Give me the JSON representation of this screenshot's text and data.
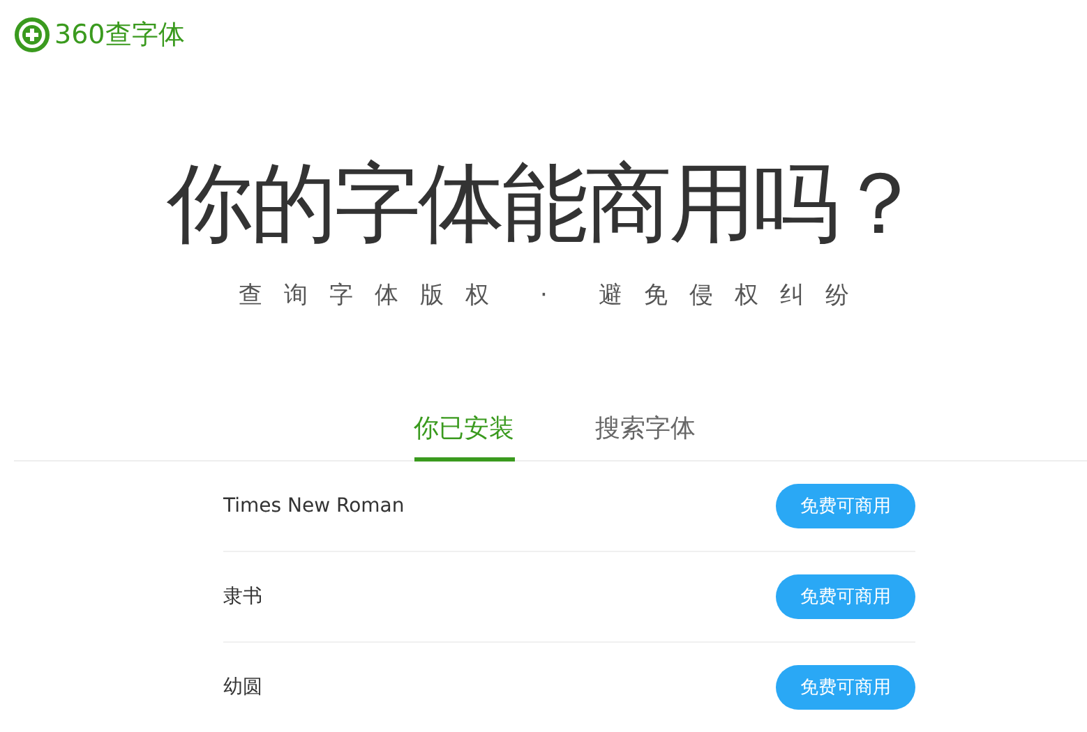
{
  "logo": {
    "text": "360查字体"
  },
  "hero": {
    "title": "你的字体能商用吗？",
    "subtitle": "查询字体版权 · 避免侵权纠纷"
  },
  "tabs": [
    {
      "label": "你已安装",
      "selected": true
    },
    {
      "label": "搜索字体",
      "selected": false
    }
  ],
  "fonts": [
    {
      "name": "Times New Roman",
      "status": "免费可商用"
    },
    {
      "name": "隶书",
      "status": "免费可商用"
    },
    {
      "name": "幼圆",
      "status": "免费可商用"
    }
  ]
}
